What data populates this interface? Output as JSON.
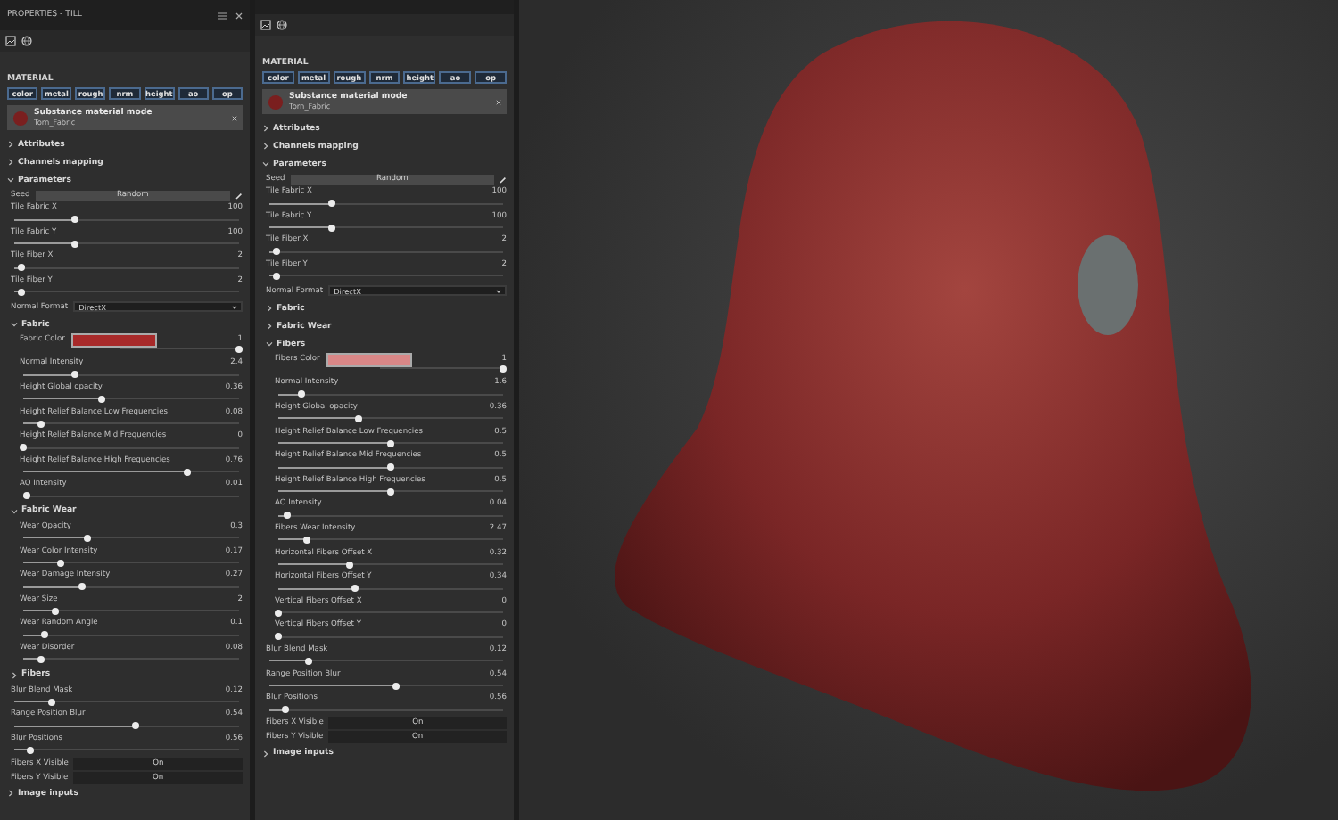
{
  "panels": [
    {
      "title": "PROPERTIES - TILL",
      "material": {
        "heading": "MATERIAL",
        "channels": [
          "color",
          "metal",
          "rough",
          "nrm",
          "height",
          "ao",
          "op"
        ],
        "node": {
          "title": "Substance material mode",
          "subtitle": "Torn_Fabric"
        }
      },
      "sections": [
        {
          "label": "Attributes",
          "expanded": false
        },
        {
          "label": "Channels mapping",
          "expanded": false
        },
        {
          "label": "Parameters",
          "expanded": true,
          "children": [
            {
              "kind": "seed",
              "label": "Seed",
              "button": "Random"
            },
            {
              "kind": "slider",
              "label": "Tile Fabric X",
              "value": "100",
              "level": 0.27
            },
            {
              "kind": "slider",
              "label": "Tile Fabric Y",
              "value": "100",
              "level": 0.27
            },
            {
              "kind": "slider",
              "label": "Tile Fiber X",
              "value": "2",
              "level": 0.03
            },
            {
              "kind": "slider",
              "label": "Tile Fiber Y",
              "value": "2",
              "level": 0.03
            },
            {
              "kind": "dropdown",
              "label": "Normal Format",
              "value": "DirectX"
            },
            {
              "kind": "group",
              "label": "Fabric",
              "expanded": true,
              "children": [
                {
                  "kind": "color",
                  "label": "Fabric Color",
                  "color": "#a82a2a",
                  "value": "1",
                  "level": 1
                },
                {
                  "kind": "slider",
                  "label": "Normal Intensity",
                  "value": "2.4",
                  "level": 0.24
                },
                {
                  "kind": "slider",
                  "label": "Height Global opacity",
                  "value": "0.36",
                  "level": 0.36
                },
                {
                  "kind": "slider",
                  "label": "Height Relief Balance Low Frequencies",
                  "value": "0.08",
                  "level": 0.08
                },
                {
                  "kind": "slider",
                  "label": "Height Relief Balance Mid Frequencies",
                  "value": "0",
                  "level": 0
                },
                {
                  "kind": "slider",
                  "label": "Height Relief Balance High Frequencies",
                  "value": "0.76",
                  "level": 0.76
                },
                {
                  "kind": "slider",
                  "label": "AO Intensity",
                  "value": "0.01",
                  "level": 0.02
                }
              ]
            },
            {
              "kind": "group",
              "label": "Fabric Wear",
              "expanded": true,
              "children": [
                {
                  "kind": "slider",
                  "label": "Wear Opacity",
                  "value": "0.3",
                  "level": 0.3
                },
                {
                  "kind": "slider",
                  "label": "Wear Color Intensity",
                  "value": "0.17",
                  "level": 0.17
                },
                {
                  "kind": "slider",
                  "label": "Wear Damage Intensity",
                  "value": "0.27",
                  "level": 0.27
                },
                {
                  "kind": "slider",
                  "label": "Wear Size",
                  "value": "2",
                  "level": 0.15
                },
                {
                  "kind": "slider",
                  "label": "Wear Random Angle",
                  "value": "0.1",
                  "level": 0.1
                },
                {
                  "kind": "slider",
                  "label": "Wear Disorder",
                  "value": "0.08",
                  "level": 0.08
                }
              ]
            },
            {
              "kind": "group",
              "label": "Fibers",
              "expanded": false
            },
            {
              "kind": "slider",
              "label": "Blur Blend Mask",
              "value": "0.12",
              "level": 0.17
            },
            {
              "kind": "slider",
              "label": "Range Position Blur",
              "value": "0.54",
              "level": 0.54
            },
            {
              "kind": "slider",
              "label": "Blur Positions",
              "value": "0.56",
              "level": 0.07
            },
            {
              "kind": "toggle",
              "label": "Fibers X Visible",
              "value": "On"
            },
            {
              "kind": "toggle",
              "label": "Fibers Y Visible",
              "value": "On"
            }
          ]
        },
        {
          "label": "Image inputs",
          "expanded": false
        }
      ]
    },
    {
      "material": {
        "heading": "MATERIAL",
        "channels": [
          "color",
          "metal",
          "rough",
          "nrm",
          "height",
          "ao",
          "op"
        ],
        "node": {
          "title": "Substance material mode",
          "subtitle": "Torn_Fabric"
        }
      },
      "sections": [
        {
          "label": "Attributes",
          "expanded": false
        },
        {
          "label": "Channels mapping",
          "expanded": false
        },
        {
          "label": "Parameters",
          "expanded": true,
          "children": [
            {
              "kind": "seed",
              "label": "Seed",
              "button": "Random"
            },
            {
              "kind": "slider",
              "label": "Tile Fabric X",
              "value": "100",
              "level": 0.27
            },
            {
              "kind": "slider",
              "label": "Tile Fabric Y",
              "value": "100",
              "level": 0.27
            },
            {
              "kind": "slider",
              "label": "Tile Fiber X",
              "value": "2",
              "level": 0.03
            },
            {
              "kind": "slider",
              "label": "Tile Fiber Y",
              "value": "2",
              "level": 0.03
            },
            {
              "kind": "dropdown",
              "label": "Normal Format",
              "value": "DirectX"
            },
            {
              "kind": "group",
              "label": "Fabric",
              "expanded": false
            },
            {
              "kind": "group",
              "label": "Fabric Wear",
              "expanded": false
            },
            {
              "kind": "group",
              "label": "Fibers",
              "expanded": true,
              "children": [
                {
                  "kind": "color",
                  "label": "Fibers Color",
                  "color": "#d98787",
                  "value": "1",
                  "level": 1
                },
                {
                  "kind": "slider",
                  "label": "Normal Intensity",
                  "value": "1.6",
                  "level": 0.1
                },
                {
                  "kind": "slider",
                  "label": "Height Global opacity",
                  "value": "0.36",
                  "level": 0.36
                },
                {
                  "kind": "slider",
                  "label": "Height Relief Balance Low Frequencies",
                  "value": "0.5",
                  "level": 0.5
                },
                {
                  "kind": "slider",
                  "label": "Height Relief Balance Mid Frequencies",
                  "value": "0.5",
                  "level": 0.5
                },
                {
                  "kind": "slider",
                  "label": "Height Relief Balance High Frequencies",
                  "value": "0.5",
                  "level": 0.5
                },
                {
                  "kind": "slider",
                  "label": "AO Intensity",
                  "value": "0.04",
                  "level": 0.04
                },
                {
                  "kind": "slider",
                  "label": "Fibers Wear Intensity",
                  "value": "2.47",
                  "level": 0.13
                },
                {
                  "kind": "slider",
                  "label": "Horizontal Fibers Offset X",
                  "value": "0.32",
                  "level": 0.32
                },
                {
                  "kind": "slider",
                  "label": "Horizontal Fibers Offset Y",
                  "value": "0.34",
                  "level": 0.34
                },
                {
                  "kind": "slider",
                  "label": "Vertical Fibers Offset X",
                  "value": "0",
                  "level": 0
                },
                {
                  "kind": "slider",
                  "label": "Vertical Fibers Offset Y",
                  "value": "0",
                  "level": 0
                }
              ]
            },
            {
              "kind": "slider",
              "label": "Blur Blend Mask",
              "value": "0.12",
              "level": 0.17
            },
            {
              "kind": "slider",
              "label": "Range Position Blur",
              "value": "0.54",
              "level": 0.54
            },
            {
              "kind": "slider",
              "label": "Blur Positions",
              "value": "0.56",
              "level": 0.07
            },
            {
              "kind": "toggle",
              "label": "Fibers X Visible",
              "value": "On"
            },
            {
              "kind": "toggle",
              "label": "Fibers Y Visible",
              "value": "On"
            }
          ]
        },
        {
          "label": "Image inputs",
          "expanded": false
        }
      ]
    }
  ]
}
